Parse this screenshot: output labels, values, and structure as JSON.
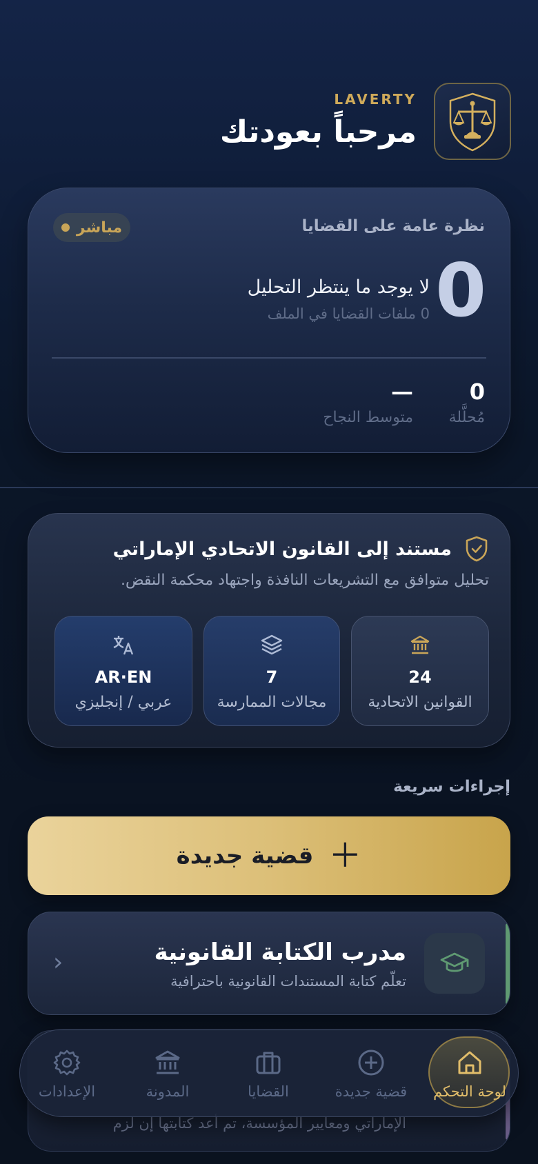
{
  "header": {
    "brand": "LAVERTY",
    "welcome": "مرحباً بعودتك"
  },
  "overview": {
    "title": "نظرة عامة على القضايا",
    "live_badge": "مباشر",
    "count": "0",
    "pending_text": "لا يوجد ما ينتظر التحليل",
    "pending_sub": "0 ملفات القضايا في الملف",
    "stats": [
      {
        "value": "0",
        "label": "مُحلَّلة"
      },
      {
        "value": "—",
        "label": "متوسط النجاح"
      }
    ]
  },
  "law_card": {
    "title": "مستند إلى القانون الاتحادي الإماراتي",
    "description": "تحليل متوافق مع التشريعات النافذة واجتهاد محكمة النقض.",
    "tiles": [
      {
        "icon": "bank-icon",
        "value": "24",
        "label": "القوانين الاتحادية"
      },
      {
        "icon": "layers-icon",
        "value": "7",
        "label": "مجالات الممارسة"
      },
      {
        "icon": "translate-icon",
        "value": "AR·EN",
        "label": "عربي / إنجليزي"
      }
    ]
  },
  "quick_actions": {
    "title": "إجراءات سريعة",
    "new_case": "قضية جديدة",
    "trainer": {
      "title": "مدرب الكتابة القانونية",
      "subtitle": "تعلّم كتابة المستندات القانونية باحترافية"
    },
    "next_card_sub": "الإماراتي ومعايير المؤسسة، تم أعد كتابتها إن لزم"
  },
  "nav": {
    "items": [
      {
        "id": "dashboard",
        "label": "لوحة التحكم",
        "icon": "home-icon",
        "active": true
      },
      {
        "id": "new-case",
        "label": "قضية جديدة",
        "icon": "plus-circle-icon",
        "active": false
      },
      {
        "id": "cases",
        "label": "القضايا",
        "icon": "briefcase-icon",
        "active": false
      },
      {
        "id": "code",
        "label": "المدونة",
        "icon": "bank-icon",
        "active": false
      },
      {
        "id": "settings",
        "label": "الإعدادات",
        "icon": "gear-icon",
        "active": false
      }
    ]
  },
  "colors": {
    "gold": "#c9a558",
    "accent_green": "#5f9a72",
    "accent_purple": "#6a5d88",
    "background": "#0b1628"
  }
}
